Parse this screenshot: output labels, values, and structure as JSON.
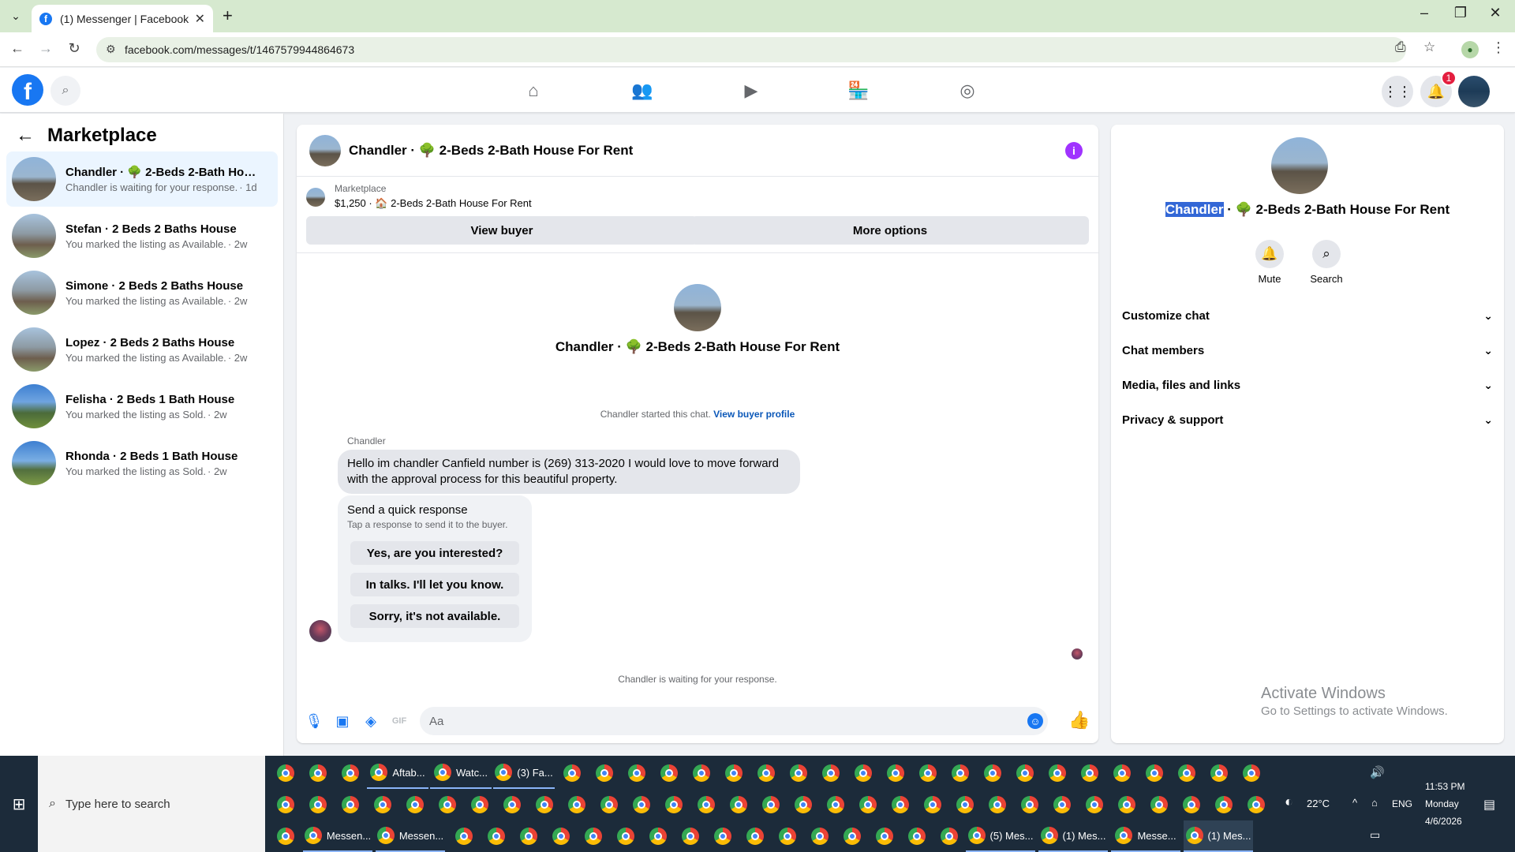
{
  "browser": {
    "tab_title": "(1) Messenger | Facebook",
    "tab_favicon": "f",
    "url": "facebook.com/messages/t/1467579944864673"
  },
  "fb": {
    "logo": "f",
    "notif_count": "1"
  },
  "sidebar": {
    "title": "Marketplace",
    "conversations": [
      {
        "name": "Chandler · 🌳 2-Beds 2-Bath Hous...",
        "sub": "Chandler is waiting for your response.",
        "time": "· 1d"
      },
      {
        "name": "Stefan · 2 Beds 2 Baths House",
        "sub": "You marked the listing as Available.",
        "time": "· 2w"
      },
      {
        "name": "Simone · 2 Beds 2 Baths House",
        "sub": "You marked the listing as Available.",
        "time": "· 2w"
      },
      {
        "name": "Lopez · 2 Beds 2 Baths House",
        "sub": "You marked the listing as Available.",
        "time": "· 2w"
      },
      {
        "name": "Felisha · 2 Beds 1 Bath House",
        "sub": "You marked the listing as Sold.",
        "time": "· 2w"
      },
      {
        "name": "Rhonda · 2 Beds 1 Bath House",
        "sub": "You marked the listing as Sold.",
        "time": "· 2w"
      }
    ]
  },
  "chat": {
    "title": "Chandler · 🌳 2-Beds 2-Bath House For Rent",
    "listing_source": "Marketplace",
    "listing_line": "$1,250 · 🏠 2-Beds 2-Bath House For Rent",
    "view_buyer": "View buyer",
    "more_options": "More options",
    "center_name": "Chandler · 🌳 2-Beds 2-Bath House For Rent",
    "started_text": "Chandler started this chat.",
    "view_buyer_profile": "View buyer profile",
    "sender": "Chandler",
    "message": "Hello im chandler Canfield number is (269) 313-2020 I would love to move forward with the approval process for this beautiful property.",
    "quick_title": "Send a quick response",
    "quick_sub": "Tap a response to send it to the buyer.",
    "quick_replies": [
      "Yes, are you interested?",
      "In talks. I'll let you know.",
      "Sorry, it's not available."
    ],
    "waiting": "Chandler is waiting for your response.",
    "composer_placeholder": "Aa"
  },
  "info": {
    "name_highlight": "Chandler",
    "name_rest": " · 🌳 2-Beds 2-Bath House For Rent",
    "mute": "Mute",
    "search": "Search",
    "sections": [
      "Customize chat",
      "Chat members",
      "Media, files and links",
      "Privacy & support"
    ],
    "activate_title": "Activate Windows",
    "activate_sub": "Go to Settings to activate Windows."
  },
  "taskbar": {
    "search_placeholder": "Type here to search",
    "row1_labels": [
      "Aftab...",
      "Watc...",
      "(3) Fa..."
    ],
    "row3_labels": [
      "Messen...",
      "Messen...",
      "(5) Mes...",
      "(1) Mes...",
      "Messe...",
      "(1) Mes..."
    ],
    "weather": "22°C",
    "lang": "ENG",
    "time": "11:53 PM",
    "day": "Monday",
    "date": "4/6/2026"
  },
  "colors": {
    "fb_blue": "#1877f2",
    "active_conv": "#ebf5ff",
    "info_purple": "#a033ff",
    "badge_red": "#e41e3f"
  }
}
